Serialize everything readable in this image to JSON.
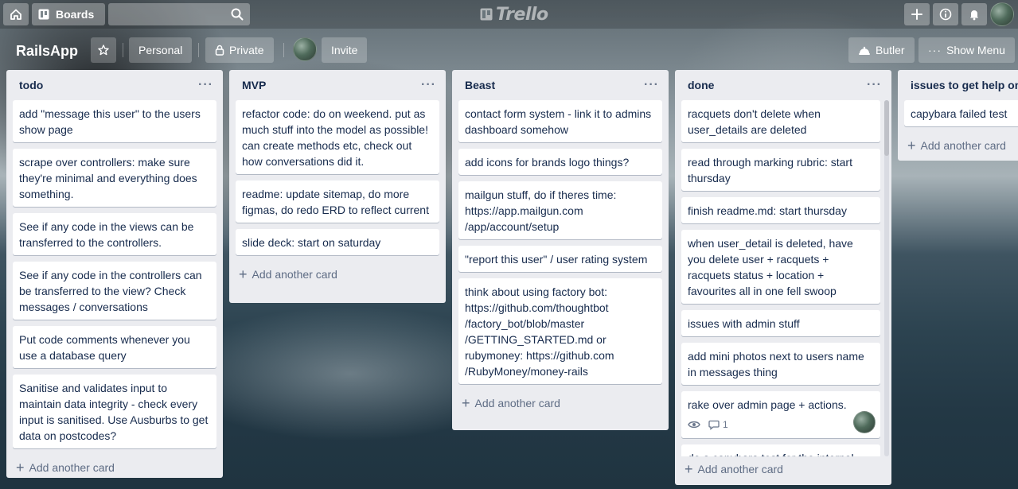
{
  "topbar": {
    "boards_label": "Boards",
    "logo_text": "Trello",
    "icons": [
      "home-icon",
      "boards-icon",
      "search-icon",
      "plus-icon",
      "info-icon",
      "bell-icon"
    ]
  },
  "board": {
    "title": "RailsApp",
    "personal_label": "Personal",
    "private_label": "Private",
    "invite_label": "Invite",
    "butler_label": "Butler",
    "show_menu_label": "Show Menu"
  },
  "lists": [
    {
      "title": "todo",
      "add_label": "Add another card",
      "cards": [
        "add \"message this user\" to the users show page",
        "scrape over controllers: make sure they're minimal and everything does something.",
        "See if any code in the views can be transferred to the controllers.",
        "See if any code in the controllers can be transferred to the view? Check messages / conversations",
        "Put code comments whenever you use a database query",
        "Sanitise and validates input to maintain data integrity - check every input is sanitised. Use Ausburbs to get data on postcodes?"
      ]
    },
    {
      "title": "MVP",
      "add_label": "Add another card",
      "cards": [
        "refactor code: do on weekend. put as much stuff into the model as possible! can create methods etc, check out how conversations did it.",
        "readme: update sitemap, do more figmas, do redo ERD to reflect current",
        "slide deck: start on saturday"
      ]
    },
    {
      "title": "Beast",
      "add_label": "Add another card",
      "cards": [
        "contact form system - link it to admins dashboard somehow",
        "add icons for brands logo things?",
        "mailgun stuff, do if theres time: https://app.mailgun.com /app/account/setup",
        "\"report this user\" / user rating system",
        "think about using factory bot: https://github.com/thoughtbot /factory_bot/blob/master /GETTING_STARTED.md or rubymoney: https://github.com /RubyMoney/money-rails"
      ]
    },
    {
      "title": "done",
      "add_label": "Add another card",
      "cards": [
        "racquets don't delete when user_details are deleted",
        "read through marking rubric: start thursday",
        "finish readme.md: start thursday",
        "when user_detail is deleted, have you delete user + racquets + racquets status + location + favourites all in one fell swoop",
        "issues with admin stuff",
        "add mini photos next to users name in messages thing",
        "rake over admin page + actions.",
        "do a capybara test for the internal"
      ],
      "badge_comment_count": "1"
    },
    {
      "title": "issues to get help on",
      "add_label": "Add another card",
      "cards": [
        "capybara failed test"
      ]
    }
  ]
}
